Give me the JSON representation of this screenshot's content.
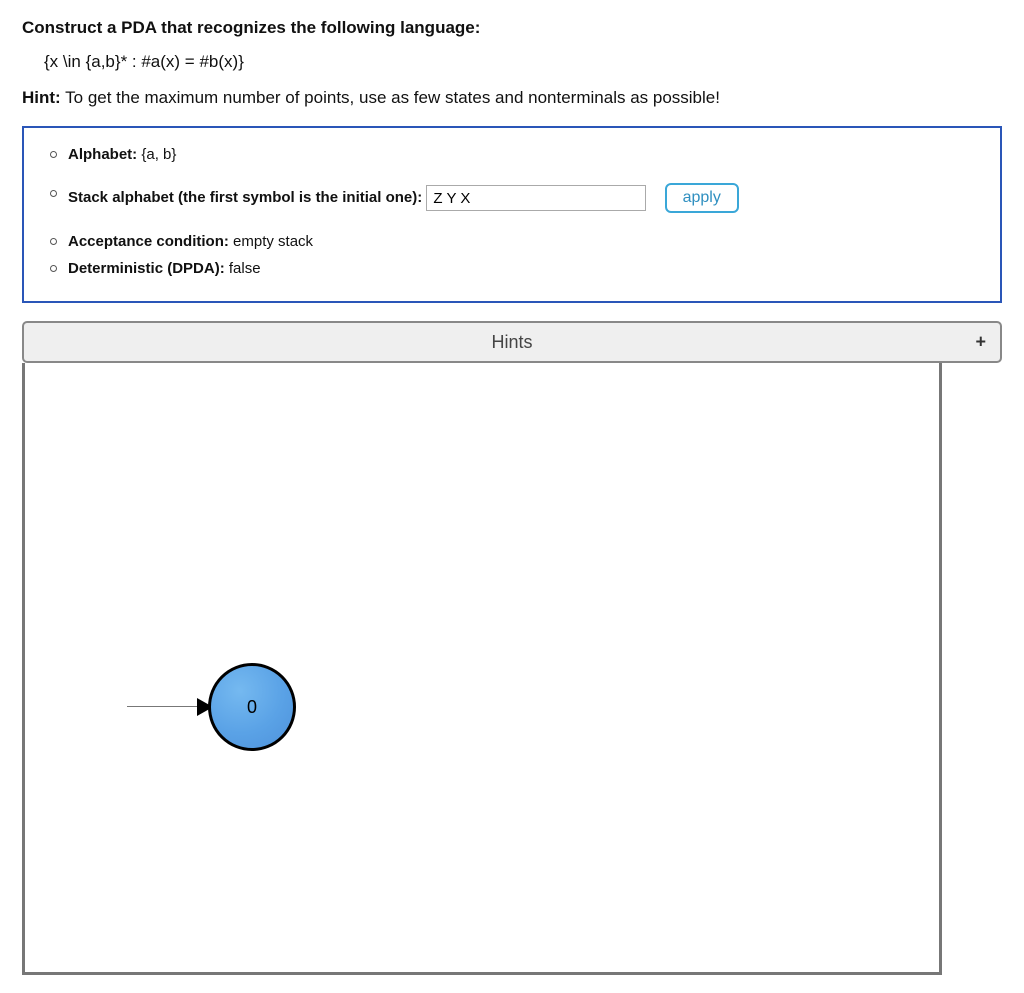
{
  "heading": "Construct a PDA that recognizes the following language:",
  "language_definition": "{x \\in {a,b}* : #a(x) = #b(x)}",
  "hint": {
    "label": "Hint:",
    "text": " To get the maximum number of points, use as few states and nonterminals as possible!"
  },
  "config": {
    "alphabet_label": "Alphabet: ",
    "alphabet_value": "{a, b}",
    "stack_label": "Stack alphabet (the first symbol is the initial one): ",
    "stack_value": "Z Y X",
    "apply_label": "apply",
    "acceptance_label": "Acceptance condition: ",
    "acceptance_value": "empty stack",
    "dpda_label": "Deterministic (DPDA): ",
    "dpda_value": "false"
  },
  "hints_bar": {
    "title": "Hints",
    "expand_symbol": "+"
  },
  "canvas": {
    "state0_label": "0"
  }
}
